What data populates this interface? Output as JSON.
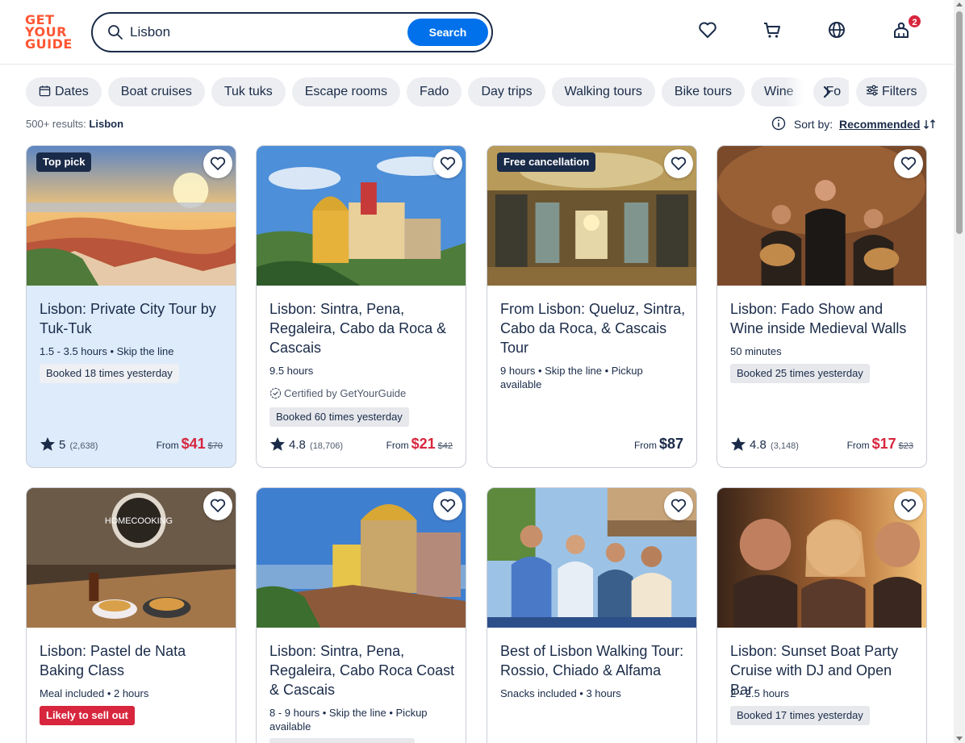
{
  "header": {
    "logo_lines": [
      "GET",
      "YOUR",
      "GUIDE"
    ],
    "search_value": "Lisbon",
    "search_button": "Search",
    "cart_badge": "2"
  },
  "chips": [
    "Dates",
    "Boat cruises",
    "Tuk tuks",
    "Escape rooms",
    "Fado",
    "Day trips",
    "Walking tours",
    "Bike tours",
    "Wine",
    "Fo"
  ],
  "filters_label": "Filters",
  "results": {
    "count": "500+ results:",
    "query": "Lisbon"
  },
  "sort": {
    "label": "Sort by:",
    "value": "Recommended"
  },
  "colors": {
    "brand": "#ff5533",
    "primary": "#0071eb",
    "sale": "#d7263d",
    "text": "#1a2b49"
  },
  "cards": [
    {
      "tag": "Top pick",
      "title": "Lisbon: Private City Tour by Tuk-Tuk",
      "meta": "1.5 - 3.5 hours • Skip the line",
      "booked": "Booked 18 times yesterday",
      "rating": "5",
      "reviews": "(2,638)",
      "from": "From",
      "price": "$41",
      "old_price": "$70"
    },
    {
      "title": "Lisbon: Sintra, Pena, Regaleira, Cabo da Roca & Cascais",
      "meta": "9.5 hours",
      "certified": "Certified by GetYourGuide",
      "booked": "Booked 60 times yesterday",
      "rating": "4.8",
      "reviews": "(18,706)",
      "from": "From",
      "price": "$21",
      "old_price": "$42"
    },
    {
      "tag": "Free cancellation",
      "title": "From Lisbon: Queluz, Sintra, Cabo da Roca, & Cascais Tour",
      "meta": "9 hours • Skip the line • Pickup available",
      "from": "From",
      "price": "$87"
    },
    {
      "title": "Lisbon: Fado Show and Wine inside Medieval Walls",
      "meta": "50 minutes",
      "booked": "Booked 25 times yesterday",
      "rating": "4.8",
      "reviews": "(3,148)",
      "from": "From",
      "price": "$17",
      "old_price": "$23"
    },
    {
      "title": "Lisbon: Pastel de Nata Baking Class",
      "meta": "Meal included • 2 hours",
      "sell_badge": "Likely to sell out",
      "sign_text": "HOMECOOKING"
    },
    {
      "title": "Lisbon: Sintra, Pena, Regaleira, Cabo Roca Coast & Cascais",
      "meta": "8 - 9 hours • Skip the line • Pickup available"
    },
    {
      "title": "Best of Lisbon Walking Tour: Rossio, Chiado & Alfama",
      "meta": "Snacks included • 3 hours"
    },
    {
      "title": "Lisbon: Sunset Boat Party Cruise with DJ and Open Bar",
      "meta": "2 - 2.5 hours",
      "booked": "Booked 17 times yesterday"
    }
  ]
}
